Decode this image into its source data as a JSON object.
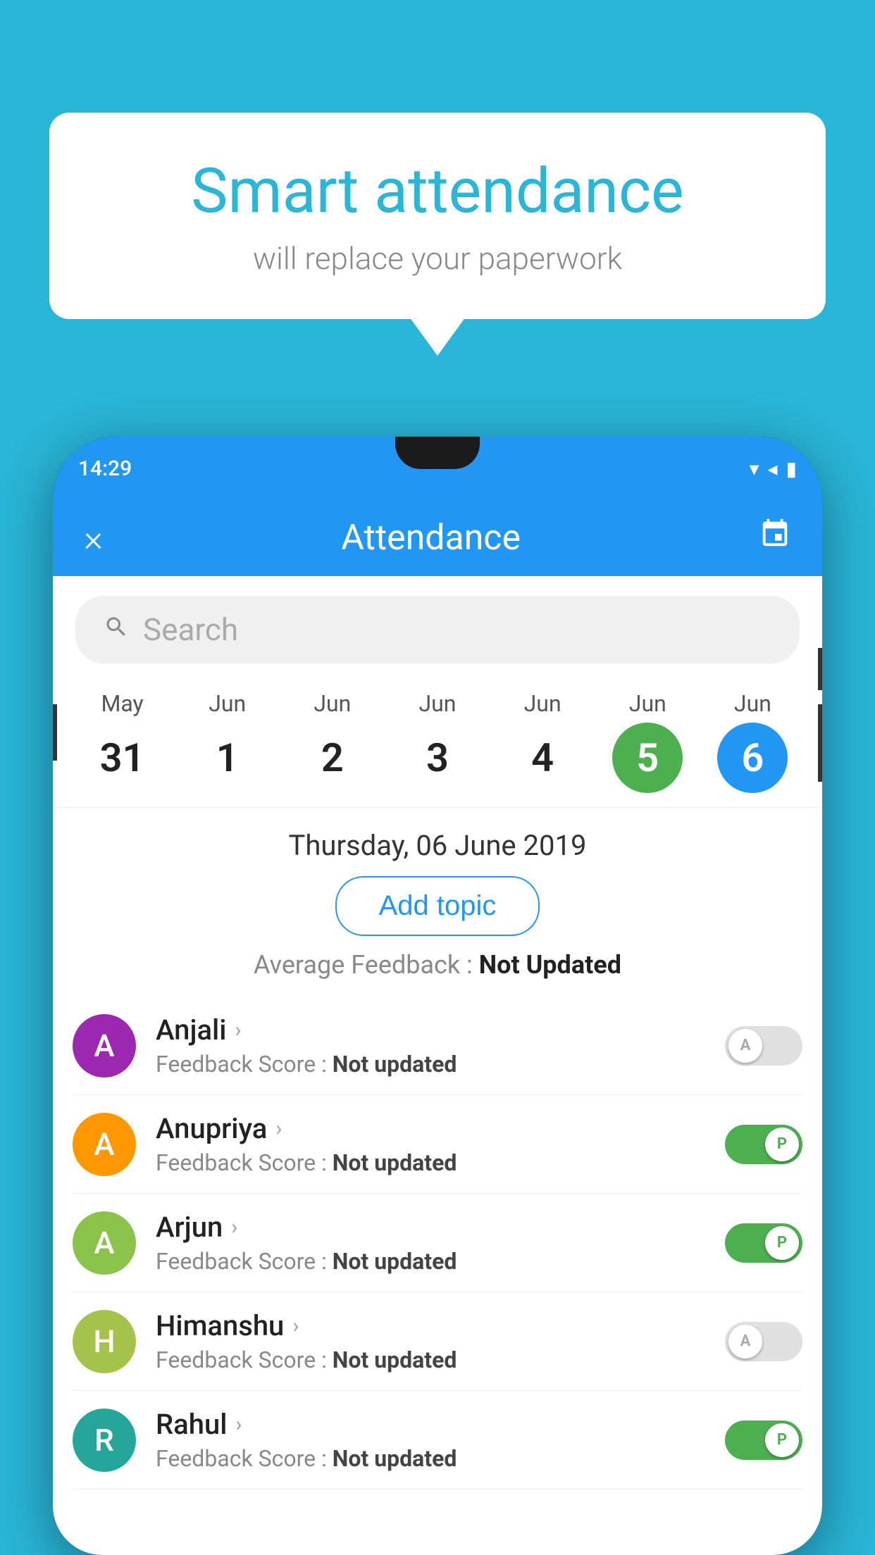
{
  "background_color": "#29b6d8",
  "bubble": {
    "title": "Smart attendance",
    "subtitle": "will replace your paperwork"
  },
  "phone": {
    "status_time": "14:29",
    "header": {
      "title": "Attendance",
      "close_label": "×",
      "calendar_label": "📅"
    },
    "search": {
      "placeholder": "Search"
    },
    "calendar": {
      "days": [
        {
          "month": "May",
          "date": "31",
          "style": "normal"
        },
        {
          "month": "Jun",
          "date": "1",
          "style": "normal"
        },
        {
          "month": "Jun",
          "date": "2",
          "style": "normal"
        },
        {
          "month": "Jun",
          "date": "3",
          "style": "normal"
        },
        {
          "month": "Jun",
          "date": "4",
          "style": "normal"
        },
        {
          "month": "Jun",
          "date": "5",
          "style": "green"
        },
        {
          "month": "Jun",
          "date": "6",
          "style": "blue"
        }
      ]
    },
    "date_header": "Thursday, 06 June 2019",
    "add_topic_label": "Add topic",
    "avg_feedback_label": "Average Feedback :",
    "avg_feedback_value": "Not Updated",
    "students": [
      {
        "name": "Anjali",
        "feedback": "Not updated",
        "avatar_letter": "A",
        "avatar_color": "purple",
        "toggle": "off",
        "toggle_letter": "A"
      },
      {
        "name": "Anupriya",
        "feedback": "Not updated",
        "avatar_letter": "A",
        "avatar_color": "orange",
        "toggle": "on",
        "toggle_letter": "P"
      },
      {
        "name": "Arjun",
        "feedback": "Not updated",
        "avatar_letter": "A",
        "avatar_color": "light-green",
        "toggle": "on",
        "toggle_letter": "P"
      },
      {
        "name": "Himanshu",
        "feedback": "Not updated",
        "avatar_letter": "H",
        "avatar_color": "olive",
        "toggle": "off",
        "toggle_letter": "A"
      },
      {
        "name": "Rahul",
        "feedback": "",
        "avatar_letter": "R",
        "avatar_color": "teal",
        "toggle": "on",
        "toggle_letter": "P"
      }
    ]
  }
}
